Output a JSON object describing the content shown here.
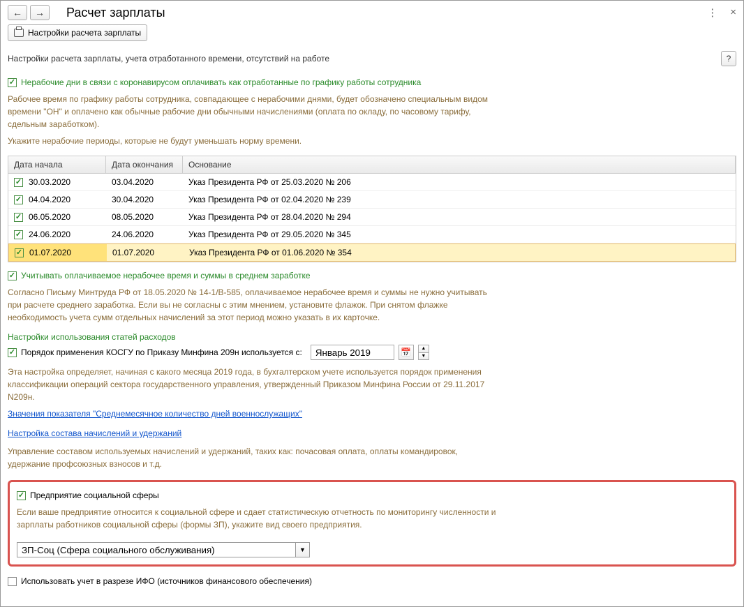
{
  "header": {
    "title": "Расчет зарплаты",
    "settings_button": "Настройки расчета зарплаты"
  },
  "subtitle": "Настройки расчета зарплаты, учета отработанного времени, отсутствий на работе",
  "covid": {
    "checkbox_label": "Нерабочие дни в связи с коронавирусом оплачивать как отработанные по графику работы сотрудника",
    "description": "Рабочее время по графику работы сотрудника, совпадающее с нерабочими днями, будет обозначено специальным видом времени \"ОН\" и оплачено как обычные рабочие дни обычными начислениями (оплата по окладу, по часовому тарифу, сдельным заработком).",
    "periods_hint": "Укажите нерабочие периоды, которые не будут уменьшать норму времени."
  },
  "table": {
    "headers": {
      "start": "Дата начала",
      "end": "Дата окончания",
      "basis": "Основание"
    },
    "rows": [
      {
        "start": "30.03.2020",
        "end": "03.04.2020",
        "basis": "Указ Президента РФ от 25.03.2020 № 206"
      },
      {
        "start": "04.04.2020",
        "end": "30.04.2020",
        "basis": "Указ Президента РФ от 02.04.2020 № 239"
      },
      {
        "start": "06.05.2020",
        "end": "08.05.2020",
        "basis": "Указ Президента РФ от 28.04.2020 № 294"
      },
      {
        "start": "24.06.2020",
        "end": "24.06.2020",
        "basis": "Указ Президента РФ от 29.05.2020 № 345"
      },
      {
        "start": "01.07.2020",
        "end": "01.07.2020",
        "basis": "Указ Президента РФ от 01.06.2020 № 354"
      }
    ],
    "selected_index": 4
  },
  "avg_earnings": {
    "checkbox_label": "Учитывать оплачиваемое нерабочее время и суммы в среднем заработке",
    "description": "Согласно Письму Минтруда РФ от 18.05.2020 № 14-1/В-585, оплачиваемое нерабочее время и суммы не нужно учитывать при расчете среднего заработка. Если вы не согласны с этим мнением, установите флажок. При снятом флажке необходимость учета сумм отдельных начислений за этот период можно указать в их карточке."
  },
  "expenses": {
    "heading": "Настройки использования статей расходов",
    "kosgu_label": "Порядок применения КОСГУ по Приказу Минфина 209н используется с:",
    "kosgu_date": "Январь 2019",
    "description": "Эта настройка определяет, начиная с какого месяца 2019 года, в бухгалтерском учете используется порядок применения классификации операций сектора государственного управления, утвержденный Приказом Минфина России от 29.11.2017 N209н."
  },
  "links": {
    "avg_days": "Значения показателя \"Среднемесячное количество дней военнослужащих\"",
    "accruals": "Настройка состава начислений и удержаний"
  },
  "accruals_desc": "Управление составом используемых начислений и удержаний, таких как: почасовая оплата, оплаты командировок, удержание профсоюзных взносов и т.д.",
  "social": {
    "checkbox_label": "Предприятие социальной сферы",
    "description": "Если ваше предприятие относится к социальной сфере и сдает статистическую отчетность по мониторингу численности и зарплаты работников социальной сферы (формы ЗП), укажите вид своего предприятия.",
    "selected": "ЗП-Соц (Сфера социального обслуживания)"
  },
  "ifo": {
    "checkbox_label": "Использовать учет в разрезе ИФО (источников финансового обеспечения)"
  }
}
